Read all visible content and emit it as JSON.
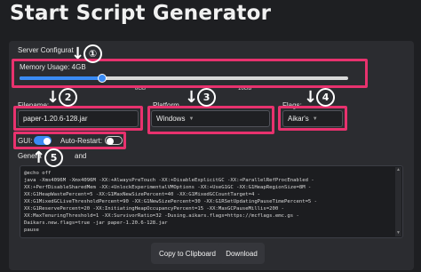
{
  "app": {
    "title": "Start Script Generator"
  },
  "server_config": {
    "section_label": "Server Configurat",
    "memory_label": "Memory Usage: 4GB",
    "memory_value_gb": 4,
    "memory_min_gb": 0,
    "memory_max_gb": 16,
    "tick_8": "8GB",
    "tick_16": "16GB",
    "filename_label": "Filename:",
    "filename_value": "paper-1.20.6-128.jar",
    "platform_label": "Platform",
    "platform_value": "Windows",
    "flags_label": "Flags:",
    "flags_value": "Aikar's",
    "gui_label": "GUI:",
    "gui_on": true,
    "autorestart_label": "Auto-Restart:",
    "autorestart_on": false
  },
  "generated": {
    "label": "Genera",
    "label_tail": "and",
    "lines": [
      "@echo off",
      "",
      "java -Xms4096M -Xmx4096M -XX:+AlwaysPreTouch -XX:+DisableExplicitGC -XX:+ParallelRefProcEnabled -",
      "XX:+PerfDisableSharedMem -XX:+UnlockExperimentalVMOptions -XX:+UseG1GC -XX:G1HeapRegionSize=8M -",
      "XX:G1HeapWastePercent=5 -XX:G1MaxNewSizePercent=40 -XX:G1MixedGCCountTarget=4 -",
      "XX:G1MixedGCLiveThresholdPercent=90 -XX:G1NewSizePercent=30 -XX:G1RSetUpdatingPauseTimePercent=5 -",
      "XX:G1ReservePercent=20 -XX:InitiatingHeapOccupancyPercent=15 -XX:MaxGCPauseMillis=200 -",
      "XX:MaxTenuringThreshold=1 -XX:SurvivorRatio=32 -Dusing.aikars.flags=https://mcflags.emc.gs -",
      "Daikars.new.flags=true -jar paper-1.20.6-128.jar",
      "",
      "pause"
    ]
  },
  "buttons": {
    "copy": "Copy to Clipboard",
    "download": "Download"
  },
  "annotations": {
    "color": "#e8326e",
    "arrow_glyph": "↓",
    "arrow_up_glyph": "↑",
    "n1": "①",
    "n2": "2",
    "n3": "3",
    "n4": "4",
    "n5": "5"
  },
  "colors": {
    "accent": "#3a8bf5",
    "background": "#1e1f22",
    "card": "#2b2c30"
  }
}
